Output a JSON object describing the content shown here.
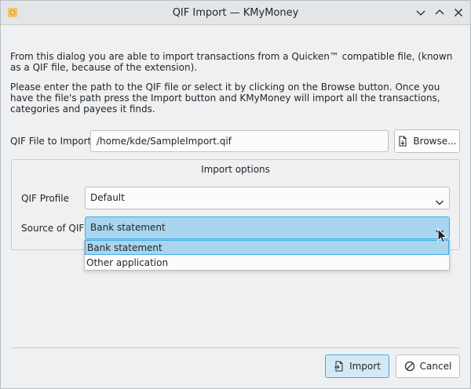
{
  "window": {
    "title": "QIF Import — KMyMoney",
    "app_icon": "kmymoney-icon",
    "controls": [
      "minimize-icon",
      "maximize-icon",
      "close-icon"
    ]
  },
  "description": {
    "line1": "From this dialog you are able to import transactions from a Quicken™ compatible file, (known as a QIF file, because of the extension).",
    "line2": "Please enter the path to the QIF file or select it by clicking on the Browse button. Once you have the file's path press the Import button and KMyMoney will import all the transactions, categories and payees it finds."
  },
  "file": {
    "label": "QIF File to Import:",
    "value": "/home/kde/SampleImport.qif",
    "browse_label": "Browse..."
  },
  "import_options": {
    "title": "Import options",
    "profile_label": "QIF Profile",
    "profile_value": "Default",
    "source_label": "Source of QIF",
    "source_value": "Bank statement",
    "source_options": [
      "Bank statement",
      "Other application"
    ]
  },
  "footer": {
    "import_label": "Import",
    "cancel_label": "Cancel"
  },
  "colors": {
    "accent": "#3daee9",
    "selection_bg": "#a9d5ee",
    "window_bg": "#eff0f1"
  }
}
